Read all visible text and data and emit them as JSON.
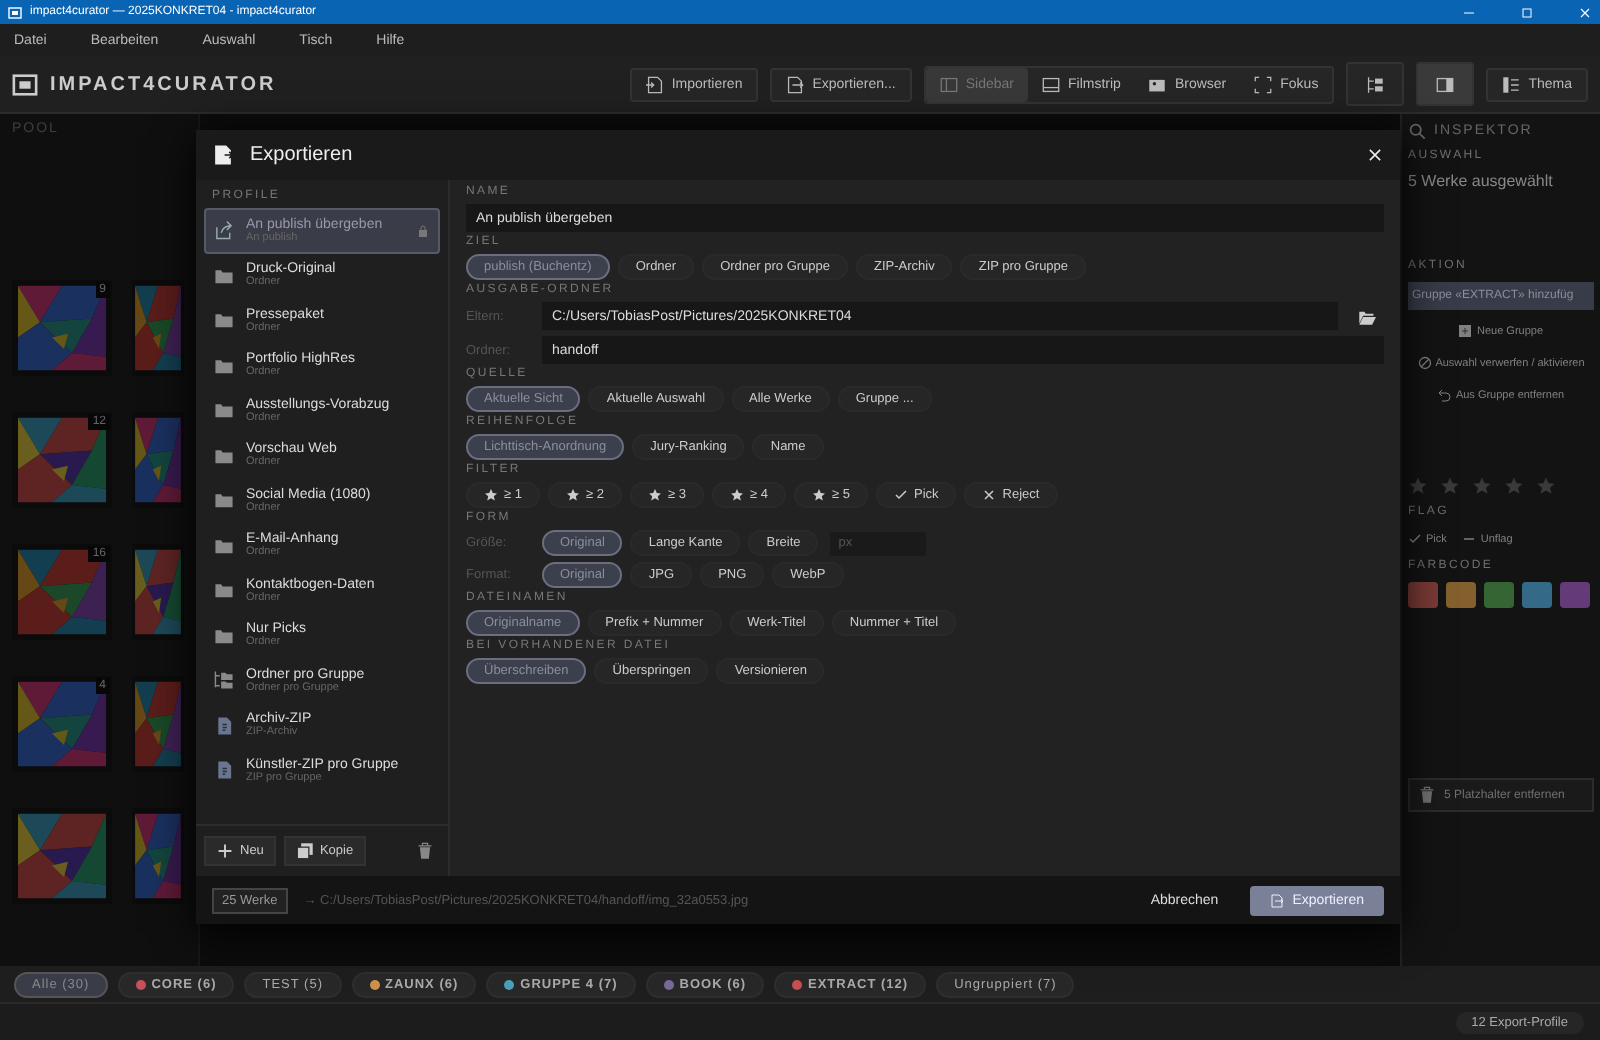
{
  "window": {
    "title": "impact4curator — 2025KONKRET04 - impact4curator"
  },
  "menu": [
    "Datei",
    "Bearbeiten",
    "Auswahl",
    "Tisch",
    "Hilfe"
  ],
  "toolbar": {
    "app_name": "IMPACT4CURATOR",
    "actions": [
      {
        "label": "Importieren",
        "kind": "import"
      },
      {
        "label": "Exportieren...",
        "kind": "export"
      }
    ],
    "views": [
      {
        "label": "Sidebar",
        "kind": "sidebar",
        "selected": true
      },
      {
        "label": "Filmstrip",
        "kind": "filmstrip",
        "selected": false
      },
      {
        "label": "Browser",
        "kind": "browser",
        "selected": false
      },
      {
        "label": "Fokus",
        "kind": "focus",
        "selected": false
      }
    ],
    "panels": [
      {
        "kind": "tree",
        "selected": false
      },
      {
        "kind": "panel",
        "selected": true
      }
    ],
    "theme": "Thema"
  },
  "pool": {
    "title": "POOL",
    "thumbnails": [
      {
        "kind": "picture",
        "badge": "9"
      },
      {
        "kind": "picture"
      },
      {
        "kind": "picture",
        "badge": "12"
      },
      {
        "kind": "picture"
      },
      {
        "kind": "picture",
        "badge": "16"
      },
      {
        "kind": "picture"
      },
      {
        "kind": "picture",
        "badge": "4"
      },
      {
        "kind": "picture"
      },
      {
        "kind": "picture"
      },
      {
        "kind": "picture"
      }
    ]
  },
  "inspector": {
    "title": "INSPEKTOR",
    "selection_label": "AUSWAHL",
    "selection": "5 Werke ausgewählt",
    "action_label": "AKTION",
    "action": "Gruppe «EXTRACT» hinzufüg",
    "buttons": [
      {
        "label": "Neue Gruppe",
        "kind": "new-group"
      },
      {
        "label": "Auswahl verwerfen / aktivieren",
        "kind": "discard"
      },
      {
        "label": "Aus Gruppe entfernen",
        "kind": "undo"
      }
    ],
    "stars": 0,
    "flag_label": "FLAG",
    "flags": [
      {
        "label": "Pick",
        "kind": "check"
      },
      {
        "label": "Unflag",
        "kind": "dash"
      }
    ],
    "color_label": "FARBCODE",
    "colors": [
      {
        "color": "#7a3a36"
      },
      {
        "color": "#84602e"
      },
      {
        "color": "#356532"
      },
      {
        "color": "#346a88"
      },
      {
        "color": "#643a78"
      }
    ],
    "remove": "5 Platzhalter entfernen"
  },
  "dialog": {
    "title": "Exportieren",
    "profiles_label": "PROFILE",
    "profiles": [
      {
        "name": "An publish übergeben",
        "sub": "An publish",
        "kind": "publish",
        "selected": true
      },
      {
        "name": "Druck-Original",
        "sub": "Ordner",
        "kind": "folder",
        "selected": false
      },
      {
        "name": "Pressepaket",
        "sub": "Ordner",
        "kind": "folder",
        "selected": false
      },
      {
        "name": "Portfolio HighRes",
        "sub": "Ordner",
        "kind": "folder",
        "selected": false
      },
      {
        "name": "Ausstellungs-Vorabzug",
        "sub": "Ordner",
        "kind": "folder",
        "selected": false
      },
      {
        "name": "Vorschau Web",
        "sub": "Ordner",
        "kind": "folder",
        "selected": false
      },
      {
        "name": "Social Media (1080)",
        "sub": "Ordner",
        "kind": "folder",
        "selected": false
      },
      {
        "name": "E-Mail-Anhang",
        "sub": "Ordner",
        "kind": "folder",
        "selected": false
      },
      {
        "name": "Kontaktbogen-Daten",
        "sub": "Ordner",
        "kind": "folder",
        "selected": false
      },
      {
        "name": "Nur Picks",
        "sub": "Ordner",
        "kind": "folder",
        "selected": false
      },
      {
        "name": "Ordner pro Gruppe",
        "sub": "Ordner pro Gruppe",
        "kind": "group",
        "selected": false
      },
      {
        "name": "Archiv-ZIP",
        "sub": "ZIP-Archiv",
        "kind": "zip",
        "selected": false
      },
      {
        "name": "Künstler-ZIP pro Gruppe",
        "sub": "ZIP pro Gruppe",
        "kind": "zip",
        "selected": false
      }
    ],
    "new": "Neu",
    "copy": "Kopie",
    "form": [
      {
        "kind": "field",
        "label": "NAME",
        "value": "An publish übergeben"
      },
      {
        "kind": "chips",
        "label": "ZIEL",
        "options": [
          {
            "label": "publish (Buchentz)",
            "selected": true
          },
          {
            "label": "Ordner",
            "selected": false
          },
          {
            "label": "Ordner pro Gruppe",
            "selected": false
          },
          {
            "label": "ZIP-Archiv",
            "selected": false
          },
          {
            "label": "ZIP pro Gruppe",
            "selected": false
          }
        ]
      },
      {
        "kind": "paths",
        "label": "AUSGABE-ORDNER",
        "rows": [
          {
            "label": "Eltern:",
            "value": "C:/Users/TobiasPost/Pictures/2025KONKRET04",
            "browse": true
          },
          {
            "label": "Ordner:",
            "value": "handoff",
            "browse": false
          }
        ]
      },
      {
        "kind": "chips",
        "label": "QUELLE",
        "options": [
          {
            "label": "Aktuelle Sicht",
            "selected": true
          },
          {
            "label": "Aktuelle Auswahl",
            "selected": false
          },
          {
            "label": "Alle Werke",
            "selected": false
          },
          {
            "label": "Gruppe ...",
            "selected": false
          }
        ]
      },
      {
        "kind": "chips",
        "label": "REIHENFOLGE",
        "options": [
          {
            "label": "Lichttisch-Anordnung",
            "selected": true
          },
          {
            "label": "Jury-Ranking",
            "selected": false
          },
          {
            "label": "Name",
            "selected": false
          }
        ]
      },
      {
        "kind": "chips",
        "label": "FILTER",
        "options": [
          {
            "label": "≥ 1",
            "kind": "star",
            "selected": false
          },
          {
            "label": "≥ 2",
            "kind": "star",
            "selected": false
          },
          {
            "label": "≥ 3",
            "kind": "star",
            "selected": false
          },
          {
            "label": "≥ 4",
            "kind": "star",
            "selected": false
          },
          {
            "label": "≥ 5",
            "kind": "star",
            "selected": false
          },
          {
            "label": "Pick",
            "kind": "check",
            "selected": false
          },
          {
            "label": "Reject",
            "kind": "cross",
            "selected": false
          }
        ]
      },
      {
        "kind": "rows",
        "label": "FORM",
        "rows": [
          {
            "label": "Größe:",
            "options": [
              {
                "label": "Original",
                "selected": true
              },
              {
                "label": "Lange Kante",
                "selected": false
              },
              {
                "label": "Breite",
                "selected": false
              }
            ],
            "placeholder": "px"
          },
          {
            "label": "Format:",
            "options": [
              {
                "label": "Original",
                "selected": true
              },
              {
                "label": "JPG",
                "selected": false
              },
              {
                "label": "PNG",
                "selected": false
              },
              {
                "label": "WebP",
                "selected": false
              }
            ]
          }
        ]
      },
      {
        "kind": "chips",
        "label": "DATEINAMEN",
        "options": [
          {
            "label": "Originalname",
            "selected": true
          },
          {
            "label": "Prefix + Nummer",
            "selected": false
          },
          {
            "label": "Werk-Titel",
            "selected": false
          },
          {
            "label": "Nummer + Titel",
            "selected": false
          }
        ]
      },
      {
        "kind": "chips",
        "label": "BEI VORHANDENER DATEI",
        "options": [
          {
            "label": "Überschreiben",
            "selected": true
          },
          {
            "label": "Überspringen",
            "selected": false
          },
          {
            "label": "Versionieren",
            "selected": false
          }
        ]
      }
    ],
    "count": "25 Werke",
    "preview": "→ C:/Users/TobiasPost/Pictures/2025KONKRET04/handoff/img_32a0553.jpg",
    "cancel": "Abbrechen",
    "export": "Exportieren"
  },
  "groups": [
    {
      "label": "Alle (30)",
      "selected": true
    },
    {
      "label": "CORE (6)",
      "color": "#c8505a",
      "selected": false
    },
    {
      "label": "TEST (5)",
      "selected": false
    },
    {
      "label": "ZAUNX (6)",
      "color": "#d0904a",
      "selected": false
    },
    {
      "label": "GRUPPE 4 (7)",
      "color": "#4aa0b8",
      "selected": false
    },
    {
      "label": "BOOK (6)",
      "color": "#7a6a9a",
      "selected": false
    },
    {
      "label": "EXTRACT (12)",
      "color": "#c85050",
      "selected": false
    },
    {
      "label": "Ungruppiert (7)",
      "selected": false
    }
  ],
  "status": {
    "profiles": "12 Export-Profile"
  }
}
